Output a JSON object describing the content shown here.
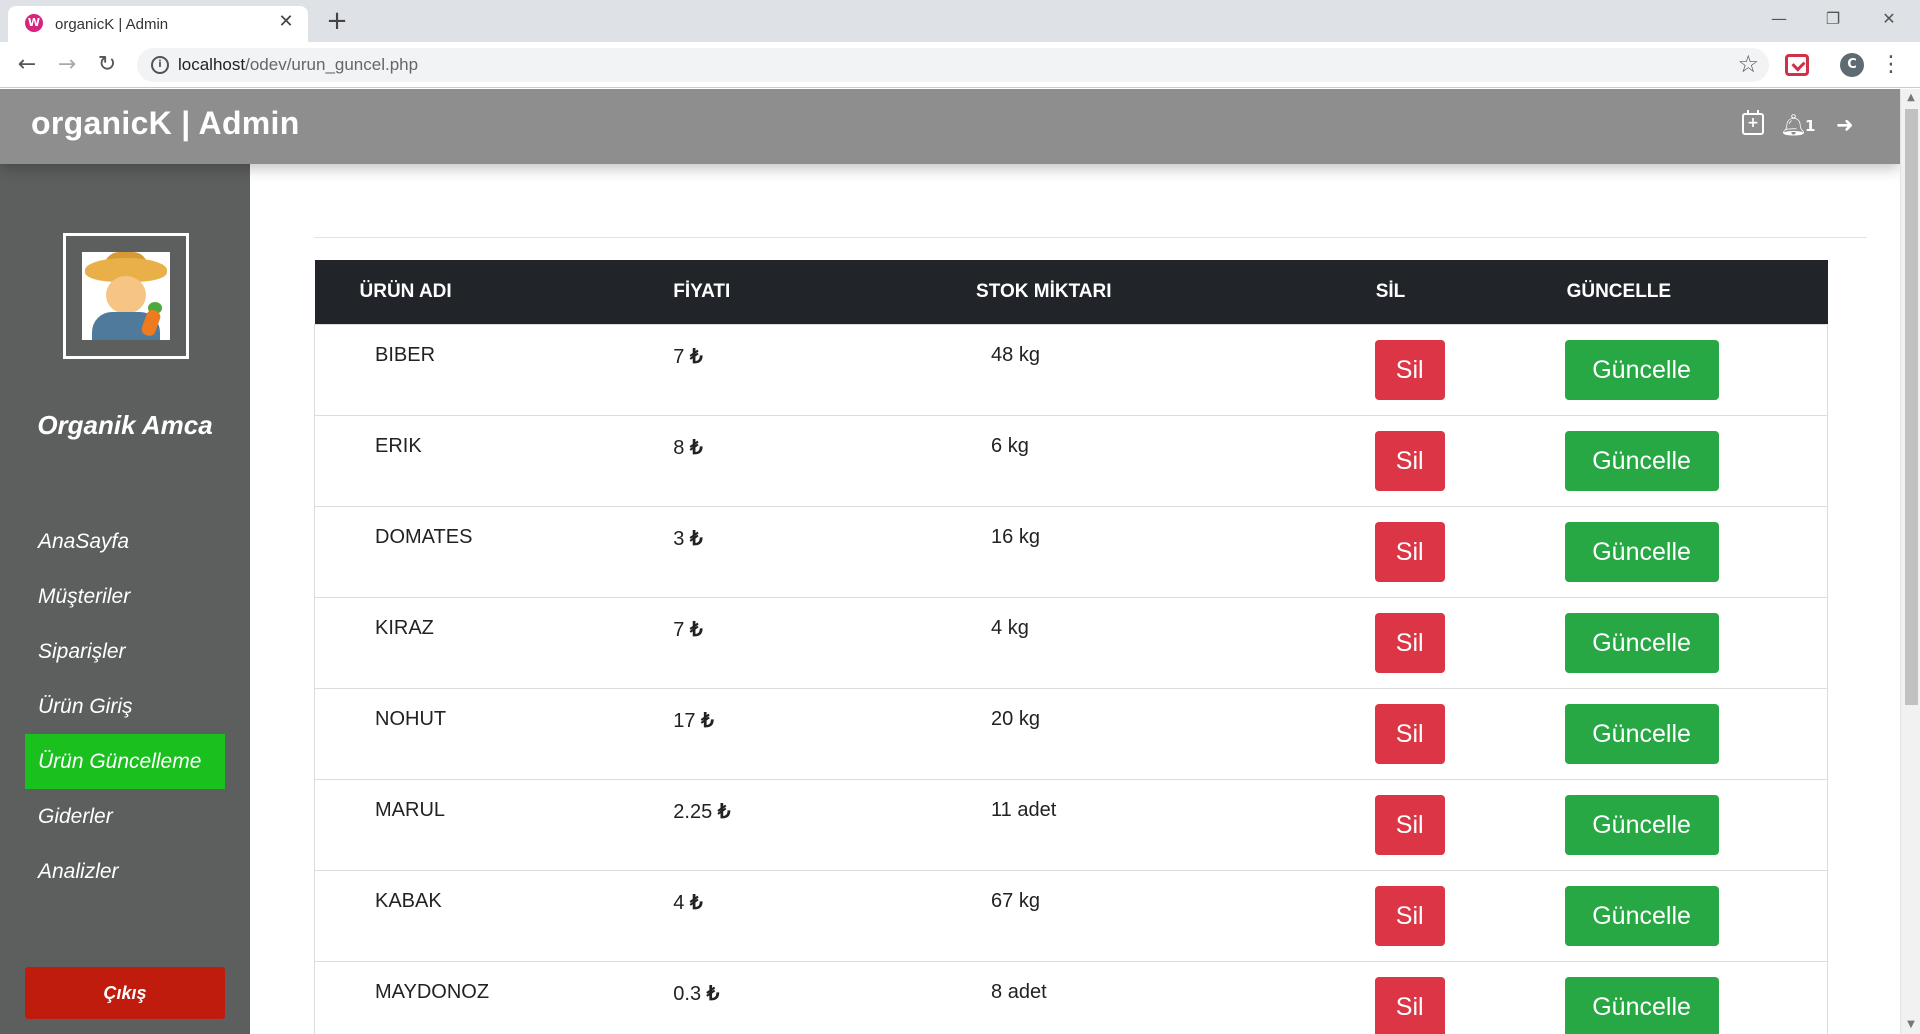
{
  "browser": {
    "tab_title": "organicK | Admin",
    "favicon_letter": "W",
    "close_glyph": "✕",
    "new_tab_glyph": "+",
    "window_min": "—",
    "window_max": "❐",
    "window_close": "✕",
    "nav_back": "←",
    "nav_forward": "→",
    "nav_reload": "↻",
    "url_host": "localhost",
    "url_path": "/odev/urun_guncel.php",
    "info_glyph": "i",
    "bookmark_glyph": "☆",
    "profile_letter": "C",
    "menu_glyph": "⋮"
  },
  "header": {
    "brand": "organicK | Admin",
    "notification_count": "1",
    "icons": [
      "calendar-plus-icon",
      "bell-icon",
      "sign-out-icon"
    ]
  },
  "sidebar": {
    "user_name": "Organik Amca",
    "items": [
      {
        "label": "AnaSayfa",
        "active": false
      },
      {
        "label": "Müşteriler",
        "active": false
      },
      {
        "label": "Siparişler",
        "active": false
      },
      {
        "label": "Ürün Giriş",
        "active": false
      },
      {
        "label": "Ürün Güncelleme",
        "active": true
      },
      {
        "label": "Giderler",
        "active": false
      },
      {
        "label": "Analizler",
        "active": false
      }
    ],
    "logout_label": "Çıkış"
  },
  "table": {
    "headers": [
      "ÜRÜN ADI",
      "FİYATI",
      "STOK MİKTARI",
      "SİL",
      "GÜNCELLE"
    ],
    "currency": "₺",
    "delete_label": "Sil",
    "update_label": "Güncelle",
    "rows": [
      {
        "name": "BIBER",
        "price": "7",
        "stock": "48 kg"
      },
      {
        "name": "ERIK",
        "price": "8",
        "stock": "6 kg"
      },
      {
        "name": "DOMATES",
        "price": "3",
        "stock": "16 kg"
      },
      {
        "name": "KIRAZ",
        "price": "7",
        "stock": "4 kg"
      },
      {
        "name": "NOHUT",
        "price": "17",
        "stock": "20 kg"
      },
      {
        "name": "MARUL",
        "price": "2.25",
        "stock": "11 adet"
      },
      {
        "name": "KABAK",
        "price": "4",
        "stock": "67 kg"
      },
      {
        "name": "MAYDONOZ",
        "price": "0.3",
        "stock": "8 adet"
      }
    ]
  },
  "colors": {
    "topbar": "#8e8e8e",
    "sidebar": "#5d5f5e",
    "active_menu": "#19c01e",
    "logout": "#c01c0d",
    "table_header": "#212529",
    "delete_button": "#dc3545",
    "update_button": "#28a745"
  }
}
